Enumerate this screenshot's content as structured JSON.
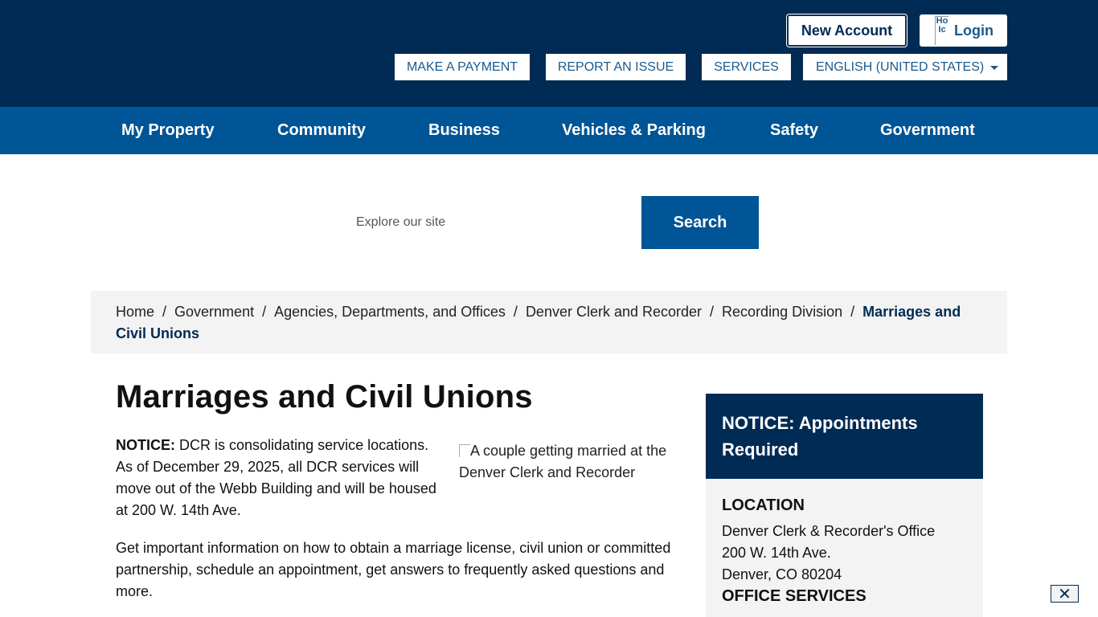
{
  "header": {
    "new_account": "New Account",
    "login_img_alt": "Ho Ic",
    "login": "Login",
    "utility": {
      "payment": "MAKE A PAYMENT",
      "report": "REPORT AN ISSUE",
      "services": "SERVICES",
      "language": "ENGLISH (UNITED STATES)"
    }
  },
  "nav": {
    "items": [
      "My Property",
      "Community",
      "Business",
      "Vehicles & Parking",
      "Safety",
      "Government"
    ]
  },
  "search": {
    "placeholder": "Explore our site",
    "button": "Search"
  },
  "breadcrumb": {
    "items": [
      "Home",
      "Government",
      "Agencies, Departments, and Offices",
      "Denver Clerk and Recorder",
      "Recording Division"
    ],
    "current": "Marriages and Civil Unions"
  },
  "main": {
    "title": "Marriages and Civil Unions",
    "notice_label": "NOTICE:",
    "notice_text": "DCR is consolidating service locations. As of December 29, 2025, all DCR services will move out of the Webb Building and will be housed at 200 W. 14th Ave.",
    "image_alt": "A couple getting married at the Denver Clerk and Recorder",
    "intro": "Get important information on how to obtain a marriage license, civil union or committed partnership, schedule an appointment, get answers to frequently asked questions and more."
  },
  "sidebar": {
    "heading": "NOTICE: Appointments Required",
    "location_heading": "LOCATION",
    "location_line1": "Denver Clerk & Recorder's Office",
    "location_line2": "200 W. 14th Ave.",
    "location_line3": "Denver, CO 80204",
    "services_heading": "OFFICE SERVICES"
  },
  "close_label": "✕"
}
